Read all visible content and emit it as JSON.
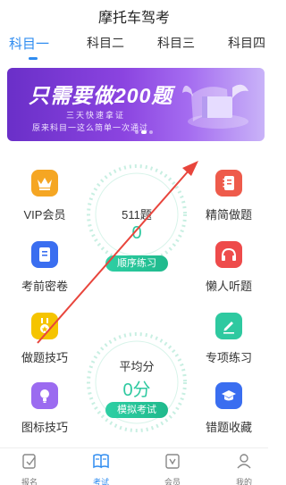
{
  "app": {
    "title": "摩托车驾考"
  },
  "tabs": [
    {
      "label": "科目一",
      "active": true
    },
    {
      "label": "科目二",
      "active": false
    },
    {
      "label": "科目三",
      "active": false
    },
    {
      "label": "科目四",
      "active": false
    }
  ],
  "banner": {
    "headline": "只需要做200题",
    "line1": "三天快速拿证",
    "line2": "原来科目一这么简单一次通过",
    "slide_count": 3,
    "active_slide": 1
  },
  "features_left": [
    {
      "label": "VIP会员",
      "icon": "crown-icon",
      "color": "#f5a623"
    },
    {
      "label": "考前密卷",
      "icon": "paper-icon",
      "color": "#3a6ef0"
    },
    {
      "label": "做题技巧",
      "icon": "medal-icon",
      "color": "#f5c400"
    },
    {
      "label": "图标技巧",
      "icon": "bulb-icon",
      "color": "#9b6bf0"
    }
  ],
  "features_right": [
    {
      "label": "精简做题",
      "icon": "notebook-icon",
      "color": "#ee5b4b"
    },
    {
      "label": "懒人听题",
      "icon": "headphone-icon",
      "color": "#ee4b4b"
    },
    {
      "label": "专项练习",
      "icon": "edit-icon",
      "color": "#2ec9a0"
    },
    {
      "label": "错题收藏",
      "icon": "graduation-cap-icon",
      "color": "#3a6ef0"
    }
  ],
  "practice_dial": {
    "count_label": "511题",
    "progress": "0",
    "button": "顺序练习"
  },
  "exam_dial": {
    "label": "平均分",
    "score": "0分",
    "button": "模拟考试"
  },
  "bottom_nav": [
    {
      "label": "报名",
      "icon": "signup-icon",
      "active": false
    },
    {
      "label": "考试",
      "icon": "book-icon",
      "active": true
    },
    {
      "label": "会员",
      "icon": "vip-card-icon",
      "active": false
    },
    {
      "label": "我的",
      "icon": "user-icon",
      "active": false
    }
  ],
  "colors": {
    "accent": "#2f8cf0",
    "green": "#1fb98c",
    "arrow": "#e8453c",
    "banner": "#7a3ad6"
  }
}
